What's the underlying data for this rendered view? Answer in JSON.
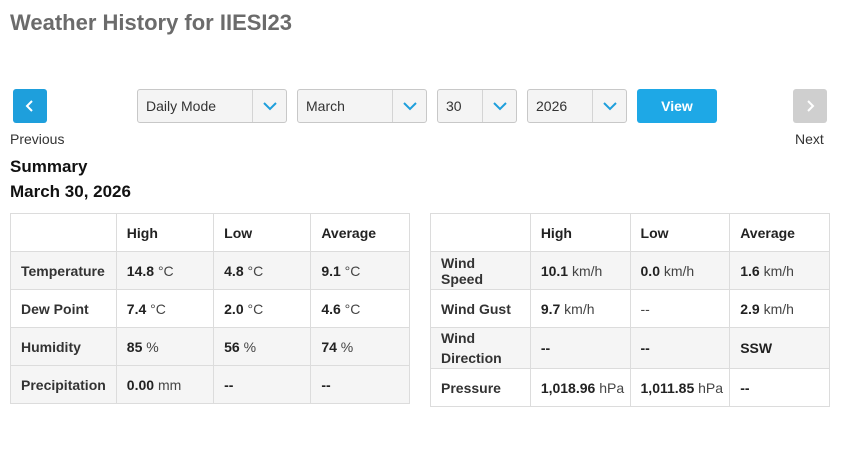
{
  "page": {
    "title": "Weather History for IIESI23"
  },
  "nav": {
    "previous_label": "Previous",
    "next_label": "Next"
  },
  "controls": {
    "mode": "Daily Mode",
    "month": "March",
    "day": "30",
    "year": "2026",
    "view_label": "View"
  },
  "summary": {
    "title": "Summary",
    "date": "March 30, 2026"
  },
  "left_table": {
    "headers": [
      "",
      "High",
      "Low",
      "Average"
    ],
    "rows": [
      {
        "label": "Temperature",
        "high": "14.8",
        "high_unit": "°C",
        "low": "4.8",
        "low_unit": "°C",
        "avg": "9.1",
        "avg_unit": "°C"
      },
      {
        "label": "Dew Point",
        "high": "7.4",
        "high_unit": "°C",
        "low": "2.0",
        "low_unit": "°C",
        "avg": "4.6",
        "avg_unit": "°C"
      },
      {
        "label": "Humidity",
        "high": "85",
        "high_unit": "%",
        "low": "56",
        "low_unit": "%",
        "avg": "74",
        "avg_unit": "%"
      },
      {
        "label": "Precipitation",
        "high": "0.00",
        "high_unit": "mm",
        "low": "--",
        "low_unit": "",
        "avg": "--",
        "avg_unit": ""
      }
    ]
  },
  "right_table": {
    "headers": [
      "",
      "High",
      "Low",
      "Average"
    ],
    "rows": [
      {
        "label": "Wind Speed",
        "high": "10.1",
        "high_unit": "km/h",
        "low": "0.0",
        "low_unit": "km/h",
        "avg": "1.6",
        "avg_unit": "km/h"
      },
      {
        "label": "Wind Gust",
        "high": "9.7",
        "high_unit": "km/h",
        "low": "--",
        "low_unit": "",
        "avg": "2.9",
        "avg_unit": "km/h"
      },
      {
        "label": "Wind Direction",
        "high": "--",
        "high_unit": "",
        "low": "--",
        "low_unit": "",
        "avg": "SSW",
        "avg_unit": ""
      },
      {
        "label": "Pressure",
        "high": "1,018.96",
        "high_unit": "hPa",
        "low": "1,011.85",
        "low_unit": "hPa",
        "avg": "--",
        "avg_unit": ""
      }
    ]
  },
  "colors": {
    "accent": "#1ea8e6",
    "title_gray": "#6b6b6b",
    "disabled_gray": "#cfcfcf"
  }
}
